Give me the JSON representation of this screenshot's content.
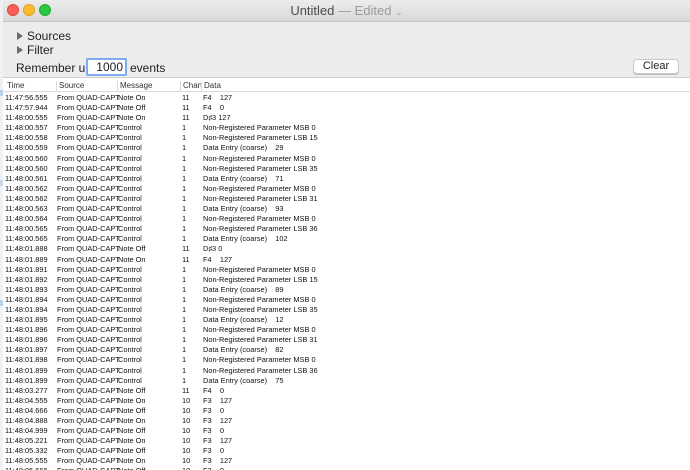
{
  "window": {
    "title": "Untitled",
    "title_separator": " — ",
    "title_status": "Edited",
    "title_chevron": "⌄"
  },
  "panel": {
    "sources_label": "Sources",
    "filter_label": "Filter",
    "remember_label": "Remember up to",
    "remember_value": "1000",
    "events_label": "events",
    "clear_label": "Clear"
  },
  "columns": {
    "time": "Time",
    "source": "Source",
    "message": "Message",
    "chan": "Chan",
    "data": "Data"
  },
  "rows": [
    [
      "11:47:56.555",
      "From QUAD-CAPTURE",
      "Note On",
      "11",
      "F4    127"
    ],
    [
      "11:47:57.944",
      "From QUAD-CAPTURE",
      "Note Off",
      "11",
      "F4    0"
    ],
    [
      "11:48:00.555",
      "From QUAD-CAPTURE",
      "Note On",
      "11",
      "D♯3 127"
    ],
    [
      "11:48:00.557",
      "From QUAD-CAPTURE",
      "Control",
      "1",
      "Non-Registered Parameter MSB 0"
    ],
    [
      "11:48:00.558",
      "From QUAD-CAPTURE",
      "Control",
      "1",
      "Non-Registered Parameter LSB 15"
    ],
    [
      "11:48:00.559",
      "From QUAD-CAPTURE",
      "Control",
      "1",
      "Data Entry (coarse)    29"
    ],
    [
      "11:48:00.560",
      "From QUAD-CAPTURE",
      "Control",
      "1",
      "Non-Registered Parameter MSB 0"
    ],
    [
      "11:48:00.560",
      "From QUAD-CAPTURE",
      "Control",
      "1",
      "Non-Registered Parameter LSB 35"
    ],
    [
      "11:48:00.561",
      "From QUAD-CAPTURE",
      "Control",
      "1",
      "Data Entry (coarse)    71"
    ],
    [
      "11:48:00.562",
      "From QUAD-CAPTURE",
      "Control",
      "1",
      "Non-Registered Parameter MSB 0"
    ],
    [
      "11:48:00.562",
      "From QUAD-CAPTURE",
      "Control",
      "1",
      "Non-Registered Parameter LSB 31"
    ],
    [
      "11:48:00.563",
      "From QUAD-CAPTURE",
      "Control",
      "1",
      "Data Entry (coarse)    93"
    ],
    [
      "11:48:00.564",
      "From QUAD-CAPTURE",
      "Control",
      "1",
      "Non-Registered Parameter MSB 0"
    ],
    [
      "11:48:00.565",
      "From QUAD-CAPTURE",
      "Control",
      "1",
      "Non-Registered Parameter LSB 36"
    ],
    [
      "11:48:00.565",
      "From QUAD-CAPTURE",
      "Control",
      "1",
      "Data Entry (coarse)    102"
    ],
    [
      "11:48:01.888",
      "From QUAD-CAPTURE",
      "Note Off",
      "11",
      "D♯3 0"
    ],
    [
      "11:48:01.889",
      "From QUAD-CAPTURE",
      "Note On",
      "11",
      "F4    127"
    ],
    [
      "11:48:01.891",
      "From QUAD-CAPTURE",
      "Control",
      "1",
      "Non-Registered Parameter MSB 0"
    ],
    [
      "11:48:01.892",
      "From QUAD-CAPTURE",
      "Control",
      "1",
      "Non-Registered Parameter LSB 15"
    ],
    [
      "11:48:01.893",
      "From QUAD-CAPTURE",
      "Control",
      "1",
      "Data Entry (coarse)    89"
    ],
    [
      "11:48:01.894",
      "From QUAD-CAPTURE",
      "Control",
      "1",
      "Non-Registered Parameter MSB 0"
    ],
    [
      "11:48:01.894",
      "From QUAD-CAPTURE",
      "Control",
      "1",
      "Non-Registered Parameter LSB 35"
    ],
    [
      "11:48:01.895",
      "From QUAD-CAPTURE",
      "Control",
      "1",
      "Data Entry (coarse)    12"
    ],
    [
      "11:48:01.896",
      "From QUAD-CAPTURE",
      "Control",
      "1",
      "Non-Registered Parameter MSB 0"
    ],
    [
      "11:48:01.896",
      "From QUAD-CAPTURE",
      "Control",
      "1",
      "Non-Registered Parameter LSB 31"
    ],
    [
      "11:48:01.897",
      "From QUAD-CAPTURE",
      "Control",
      "1",
      "Data Entry (coarse)    82"
    ],
    [
      "11:48:01.898",
      "From QUAD-CAPTURE",
      "Control",
      "1",
      "Non-Registered Parameter MSB 0"
    ],
    [
      "11:48:01.899",
      "From QUAD-CAPTURE",
      "Control",
      "1",
      "Non-Registered Parameter LSB 36"
    ],
    [
      "11:48:01.899",
      "From QUAD-CAPTURE",
      "Control",
      "1",
      "Data Entry (coarse)    75"
    ],
    [
      "11:48:03.277",
      "From QUAD-CAPTURE",
      "Note Off",
      "11",
      "F4    0"
    ],
    [
      "11:48:04.555",
      "From QUAD-CAPTURE",
      "Note On",
      "10",
      "F3    127"
    ],
    [
      "11:48:04.666",
      "From QUAD-CAPTURE",
      "Note Off",
      "10",
      "F3    0"
    ],
    [
      "11:48:04.888",
      "From QUAD-CAPTURE",
      "Note On",
      "10",
      "F3    127"
    ],
    [
      "11:48:04.999",
      "From QUAD-CAPTURE",
      "Note Off",
      "10",
      "F3    0"
    ],
    [
      "11:48:05.221",
      "From QUAD-CAPTURE",
      "Note On",
      "10",
      "F3    127"
    ],
    [
      "11:48:05.332",
      "From QUAD-CAPTURE",
      "Note Off",
      "10",
      "F3    0"
    ],
    [
      "11:48:05.555",
      "From QUAD-CAPTURE",
      "Note On",
      "10",
      "F3    127"
    ],
    [
      "11:48:05.666",
      "From QUAD-CAPTURE",
      "Note Off",
      "10",
      "F3    0"
    ]
  ],
  "colors": {
    "close": "#fc5f57",
    "minimize": "#fdbc2e",
    "maximize": "#28c840",
    "focus_ring": "#7daaf0"
  }
}
